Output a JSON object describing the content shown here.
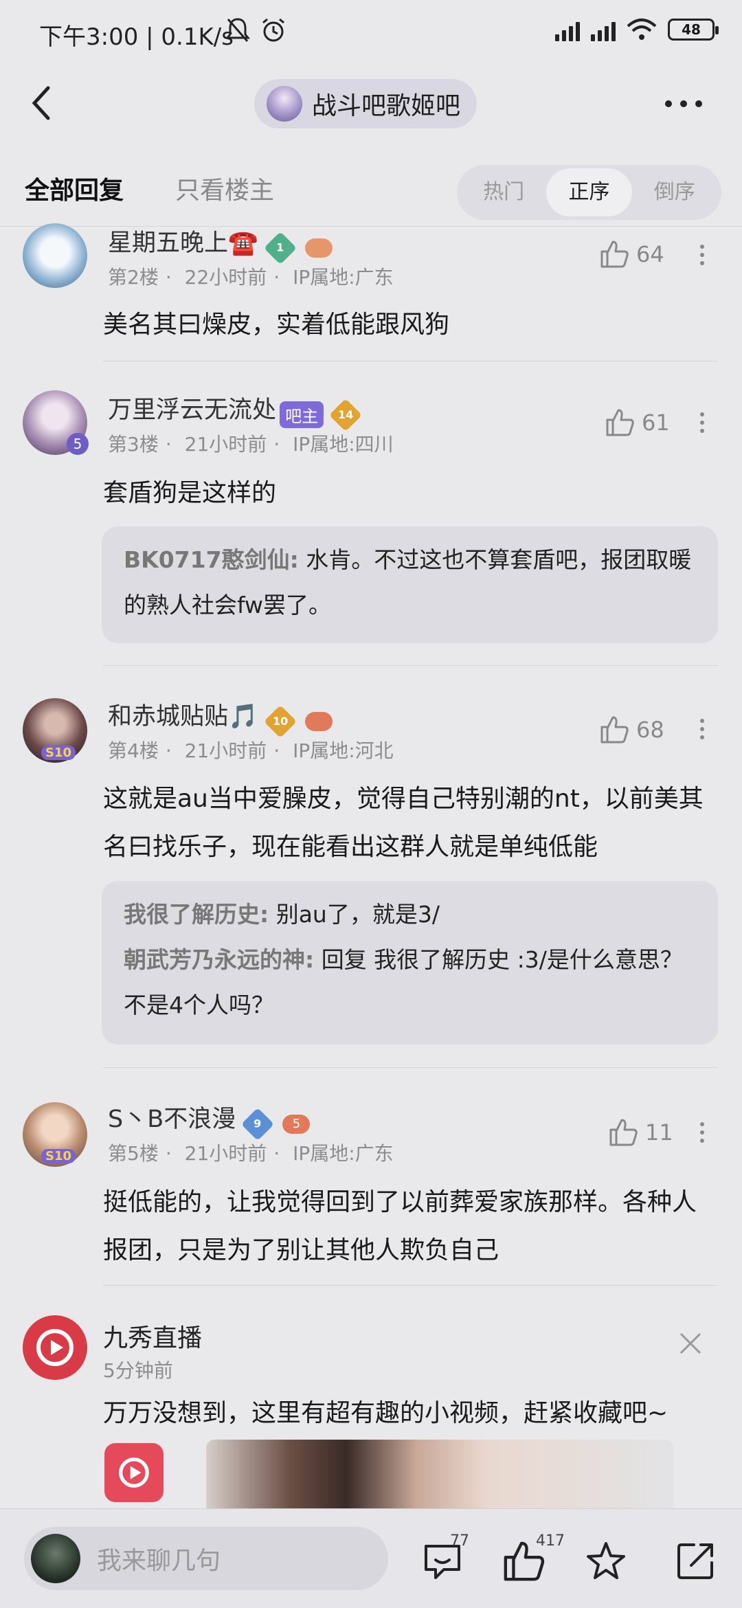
{
  "status_bar": {
    "time": "下午3:00 | 0.1K/s",
    "battery": "48"
  },
  "nav": {
    "forum_name": "战斗吧歌姬吧"
  },
  "tabs": {
    "all": "全部回复",
    "owner_only": "只看楼主",
    "sort_options": [
      "热门",
      "正序",
      "倒序"
    ],
    "sort_active": "正序"
  },
  "posts": [
    {
      "username": "星期五晚上☎️",
      "level": "1",
      "floor": "第2楼",
      "time": "22小时前",
      "location": "IP属地:广东",
      "likes": "64",
      "text": "美名其曰燥皮，实着低能跟风狗"
    },
    {
      "username": "万里浮云无流处",
      "owner_badge": "吧主",
      "level": "14",
      "avatar_badge": "5",
      "floor": "第3楼",
      "time": "21小时前",
      "location": "IP属地:四川",
      "likes": "61",
      "text": "套盾狗是这样的",
      "replies": [
        {
          "author": "BK0717憨剑仙:",
          "text": " 水肯。不过这也不算套盾吧，报团取暖的熟人社会fw罢了。"
        }
      ]
    },
    {
      "username": "和赤城贴贴🎵",
      "level": "10",
      "avatar_badge": "S10",
      "floor": "第4楼",
      "time": "21小时前",
      "location": "IP属地:河北",
      "likes": "68",
      "text": "这就是au当中爱臊皮，觉得自己特别潮的nt，以前美其名曰找乐子，现在能看出这群人就是单纯低能",
      "replies": [
        {
          "author": "我很了解历史:",
          "text": " 别au了，就是3/"
        },
        {
          "author": "朝武芳乃永远的神:",
          "text": " 回复 我很了解历史 :3/是什么意思？不是4个人吗？"
        }
      ]
    },
    {
      "username": "S丶B不浪漫",
      "level": "9",
      "game_level": "5",
      "avatar_badge": "S10",
      "floor": "第5楼",
      "time": "21小时前",
      "location": "IP属地:广东",
      "likes": "11",
      "text": "挺低能的，让我觉得回到了以前葬爱家族那样。各种人报团，只是为了别让其他人欺负自己"
    }
  ],
  "ad": {
    "name": "九秀直播",
    "time": "5分钟前",
    "text": "万万没想到，这里有超有趣的小视频，赶紧收藏吧~"
  },
  "bottom_bar": {
    "input_placeholder": "我来聊几句",
    "comments_count": "77",
    "likes_count": "417"
  },
  "colors": {
    "accent_purple": "#7f6ad9",
    "ad_red": "#d93b46"
  }
}
